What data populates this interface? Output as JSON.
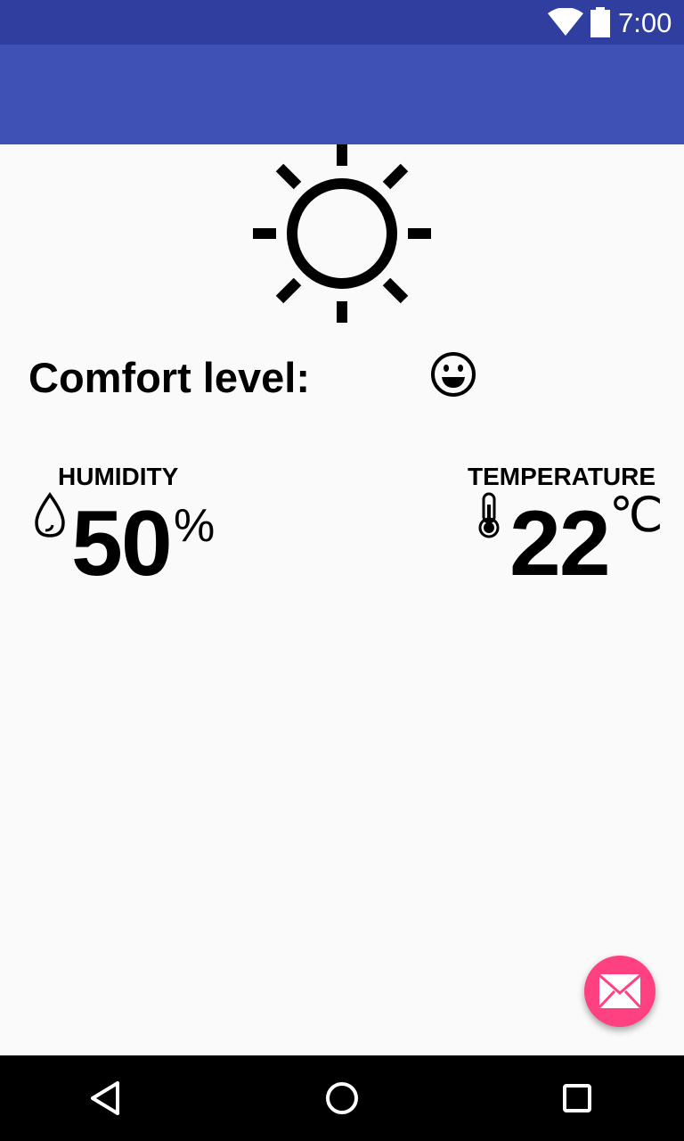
{
  "status_bar": {
    "time": "7:00",
    "icons": [
      "wifi-icon",
      "battery-icon"
    ]
  },
  "app_bar": {
    "title": ""
  },
  "weather": {
    "condition_icon": "sun-icon"
  },
  "comfort": {
    "label": "Comfort level:",
    "icon": "smiley-face-icon"
  },
  "humidity": {
    "label": "HUMIDITY",
    "value": "50",
    "unit": "%",
    "icon": "water-drop-icon"
  },
  "temperature": {
    "label": "TEMPERATURE",
    "value": "22",
    "unit": "℃",
    "icon": "thermometer-icon"
  },
  "fab": {
    "icon": "email-icon"
  },
  "nav_bar": {
    "icons": [
      "back-icon",
      "home-icon",
      "recents-icon"
    ]
  },
  "colors": {
    "status_bar": "#303f9f",
    "app_bar": "#3f51b5",
    "fab": "#ff4081",
    "background": "#fafafa",
    "nav_bar": "#000000"
  }
}
